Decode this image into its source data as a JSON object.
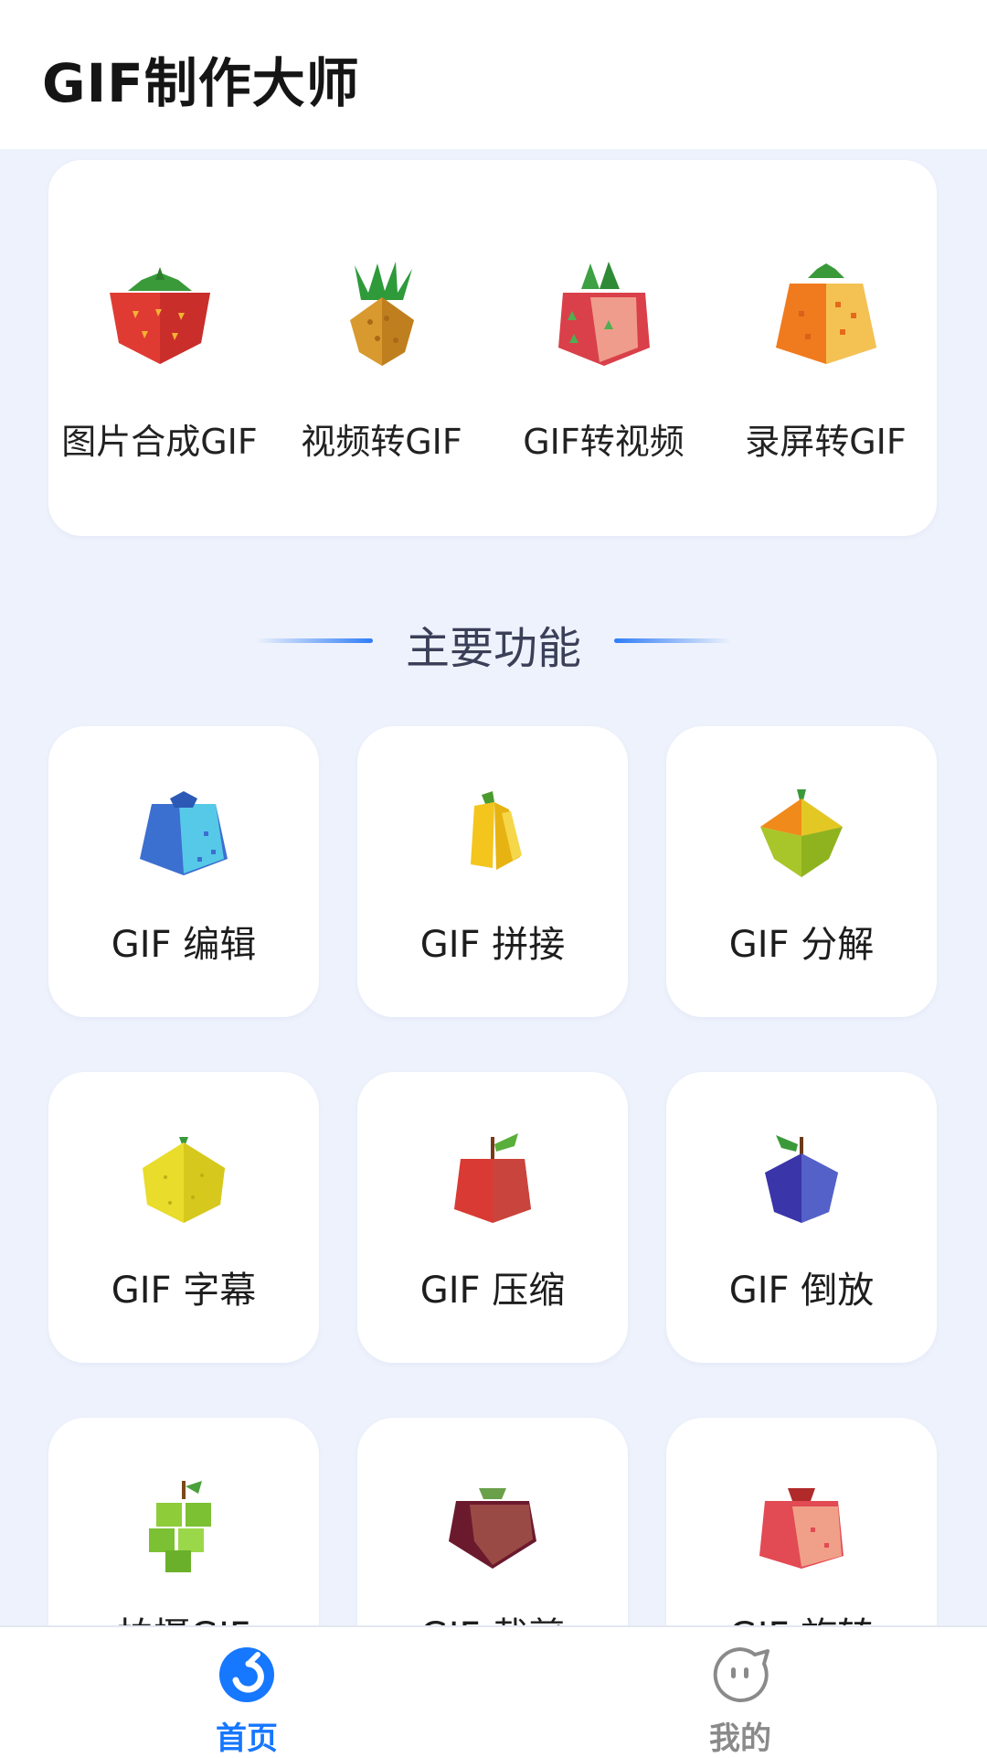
{
  "app": {
    "title": "GIF制作大师"
  },
  "quick_tools": [
    {
      "label": "图片合成GIF",
      "icon": "strawberry-icon"
    },
    {
      "label": "视频转GIF",
      "icon": "pineapple-icon"
    },
    {
      "label": "GIF转视频",
      "icon": "dragonfruit-icon"
    },
    {
      "label": "录屏转GIF",
      "icon": "orange-icon"
    }
  ],
  "section": {
    "title": "主要功能"
  },
  "features": [
    {
      "label": "GIF 编辑",
      "icon": "blueberry-icon"
    },
    {
      "label": "GIF 拼接",
      "icon": "banana-icon"
    },
    {
      "label": "GIF 分解",
      "icon": "mango-icon"
    },
    {
      "label": "GIF 字幕",
      "icon": "lemon-icon"
    },
    {
      "label": "GIF 压缩",
      "icon": "apple-icon"
    },
    {
      "label": "GIF 倒放",
      "icon": "plum-icon"
    },
    {
      "label": "拍摄GIF",
      "icon": "grapes-icon"
    },
    {
      "label": "GIF 裁剪",
      "icon": "mangosteen-icon"
    },
    {
      "label": "GIF 旋转",
      "icon": "peach-icon"
    }
  ],
  "bottom_nav": [
    {
      "label": "首页",
      "icon": "home-icon",
      "active": true,
      "color": "#1677ff"
    },
    {
      "label": "我的",
      "icon": "profile-chat-icon",
      "active": false,
      "color": "#8a8a8a"
    }
  ],
  "colors": {
    "accent": "#1677ff",
    "background": "#eef2fc"
  }
}
